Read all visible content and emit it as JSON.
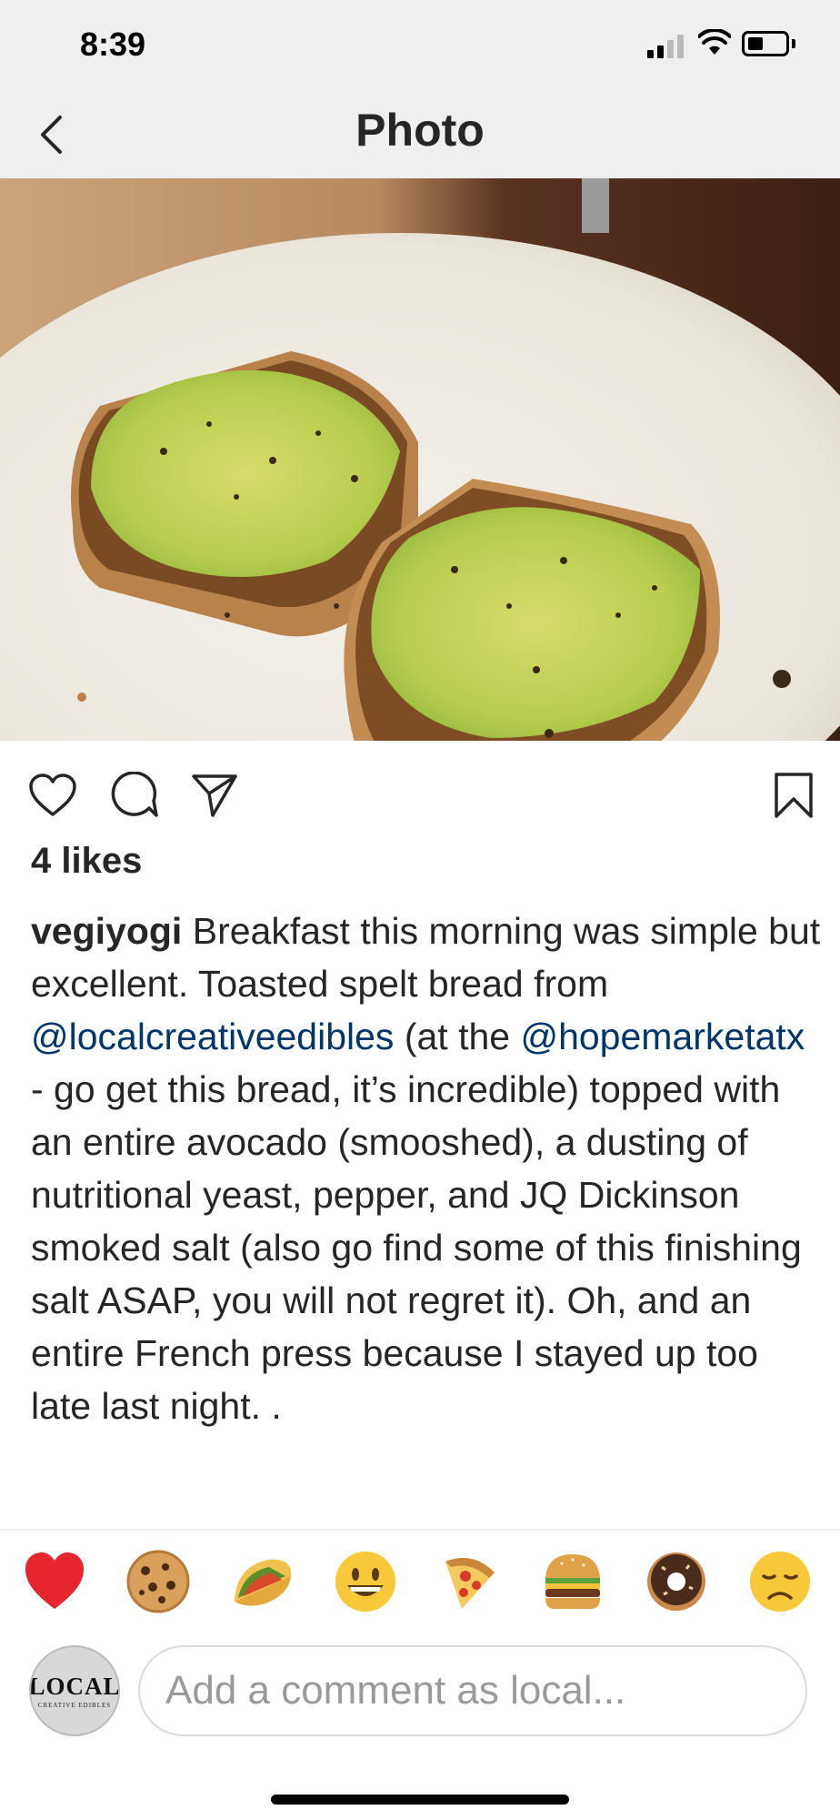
{
  "status_bar": {
    "time": "8:39"
  },
  "nav": {
    "title": "Photo"
  },
  "post": {
    "likes": "4 likes",
    "caption": {
      "username": "vegiyogi",
      "text_1": " Breakfast this morning was simple but excellent. Toasted spelt bread from ",
      "mention_1": "@localcreativeedibles",
      "text_2": " (at the ",
      "mention_2": "@hopemarketatx",
      "text_3": " - go get this bread, it’s incredible) topped with an entire avocado (smooshed), a dusting of nutritional yeast, pepper, and JQ Dickinson smoked salt (also go find some of this finishing salt ASAP, you will not regret it). Oh, and an entire French press because I stayed up too late last night. ."
    }
  },
  "quick_reactions": [
    {
      "icon": "red-heart-emoji"
    },
    {
      "icon": "cookie-emoji"
    },
    {
      "icon": "taco-emoji"
    },
    {
      "icon": "grinning-face-emoji"
    },
    {
      "icon": "pizza-emoji"
    },
    {
      "icon": "hamburger-emoji"
    },
    {
      "icon": "doughnut-emoji"
    },
    {
      "icon": "disappointed-face-emoji"
    }
  ],
  "comment": {
    "avatar_text": "LOCAL",
    "avatar_subtext": "CREATIVE EDIBLES",
    "placeholder": "Add a comment as local..."
  },
  "colors": {
    "mention": "#003569",
    "text": "#262626",
    "bar_bg": "#efefef"
  }
}
